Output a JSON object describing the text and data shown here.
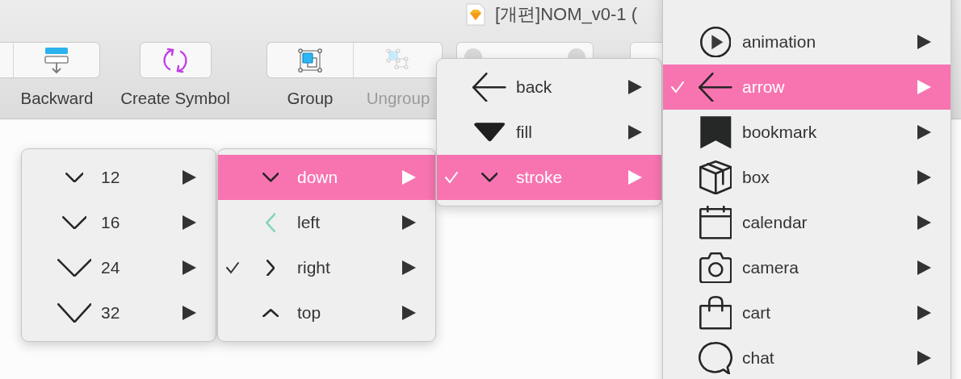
{
  "window": {
    "title": "[개편]NOM_v0-1 ("
  },
  "toolbar": {
    "buttons": [
      {
        "label": "Backward",
        "disabled": false
      },
      {
        "label": "Create Symbol",
        "disabled": false
      },
      {
        "label": "Group",
        "disabled": false
      },
      {
        "label": "Ungroup",
        "disabled": true
      }
    ]
  },
  "menus": [
    {
      "items": [
        {
          "label": "12",
          "checked": false,
          "selected": false
        },
        {
          "label": "16",
          "checked": false,
          "selected": false
        },
        {
          "label": "24",
          "checked": false,
          "selected": false
        },
        {
          "label": "32",
          "checked": false,
          "selected": false
        }
      ]
    },
    {
      "items": [
        {
          "label": "down",
          "checked": false,
          "selected": true
        },
        {
          "label": "left",
          "checked": false,
          "selected": false
        },
        {
          "label": "right",
          "checked": true,
          "selected": false
        },
        {
          "label": "top",
          "checked": false,
          "selected": false
        }
      ]
    },
    {
      "items": [
        {
          "label": "back",
          "checked": false,
          "selected": false
        },
        {
          "label": "fill",
          "checked": false,
          "selected": false
        },
        {
          "label": "stroke",
          "checked": true,
          "selected": true
        }
      ]
    },
    {
      "items": [
        {
          "label": "animation",
          "checked": false,
          "selected": false
        },
        {
          "label": "arrow",
          "checked": true,
          "selected": true
        },
        {
          "label": "bookmark",
          "checked": false,
          "selected": false
        },
        {
          "label": "box",
          "checked": false,
          "selected": false
        },
        {
          "label": "calendar",
          "checked": false,
          "selected": false
        },
        {
          "label": "camera",
          "checked": false,
          "selected": false
        },
        {
          "label": "cart",
          "checked": false,
          "selected": false
        },
        {
          "label": "chat",
          "checked": false,
          "selected": false
        }
      ]
    }
  ]
}
